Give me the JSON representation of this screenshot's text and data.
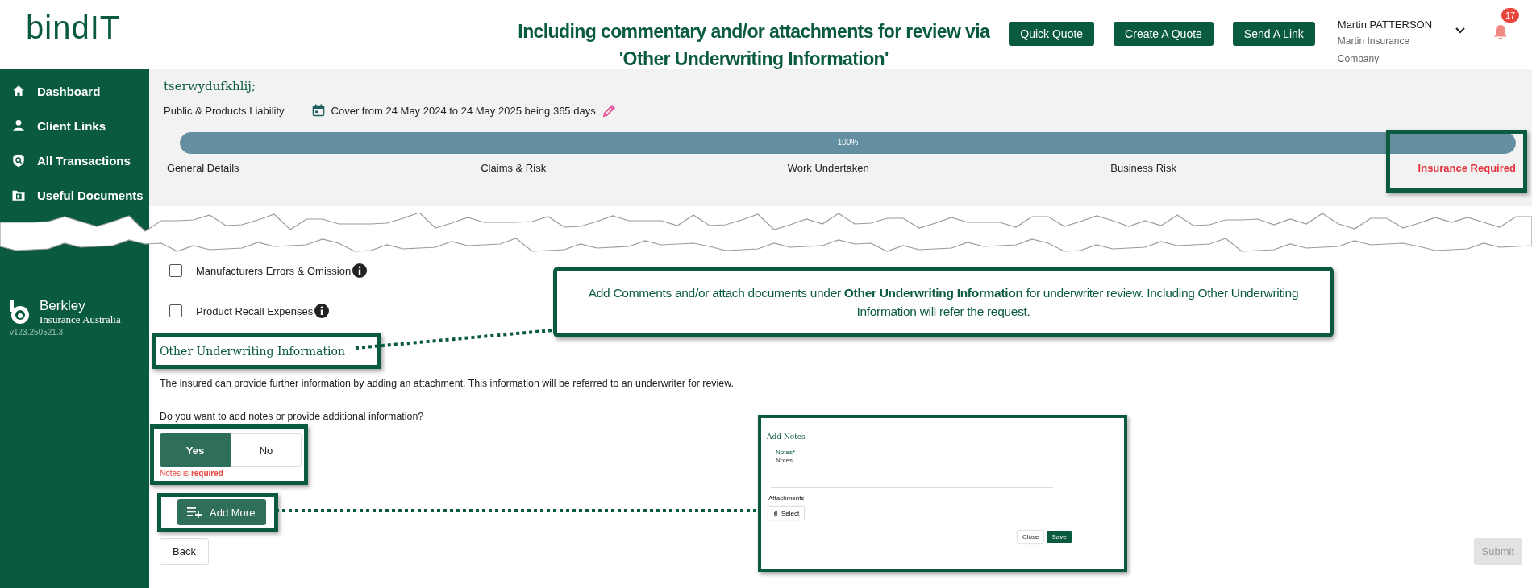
{
  "header": {
    "logo": "bindIT",
    "title_lines": [
      "Including commentary and/or attachments for review via",
      "'Other Underwriting Information'"
    ],
    "buttons": [
      "Quick Quote",
      "Create A Quote",
      "Send A Link"
    ],
    "user": {
      "name": "Martin PATTERSON",
      "company": "Martin Insurance Company"
    },
    "notifications": "17"
  },
  "sidebar": {
    "items": [
      {
        "label": "Dashboard",
        "kind": "home"
      },
      {
        "label": "Client Links",
        "kind": "person"
      },
      {
        "label": "All Transactions",
        "kind": "shield"
      },
      {
        "label": "Useful Documents",
        "kind": "document"
      }
    ],
    "brand": {
      "name": "Berkley",
      "subtitle": "Insurance Australia"
    },
    "version": "v123.250521.3"
  },
  "quote": {
    "title": "tserwydufkhlij;",
    "product": "Public & Products Liability",
    "cover": "Cover from 24 May 2024 to 24 May 2025 being 365 days",
    "progress": {
      "level": 1,
      "label": "100%"
    },
    "steps": [
      {
        "label": "General Details",
        "selected": false
      },
      {
        "label": "Claims & Risk",
        "selected": false
      },
      {
        "label": "Work Undertaken",
        "selected": false
      },
      {
        "label": "Business Risk",
        "selected": false
      },
      {
        "label": "Insurance Required",
        "selected": true
      }
    ]
  },
  "options": [
    {
      "label": "Manufacturers Errors & Omission",
      "checked": false
    },
    {
      "label": "Product Recall Expenses",
      "checked": false
    }
  ],
  "other_info": {
    "heading": "Other Underwriting Information",
    "description": "The insured can provide further information by adding an attachment. This information will be referred to an underwriter for review.",
    "question": "Do you want to add notes or provide additional information?",
    "choices": [
      {
        "label": "Yes",
        "selected": true
      },
      {
        "label": "No",
        "selected": false
      }
    ],
    "error": "Notes is **required**",
    "add_more": "Add More"
  },
  "footer": {
    "back": "Back",
    "submit": {
      "label": "Submit",
      "disabled": true
    }
  },
  "callout": {
    "text": "Add Comments and/or attach documents under **Other Underwriting Information** for underwriter review.  Including Other Underwriting Information will refer the request."
  },
  "inset": {
    "title": "Add Notes",
    "field_label": "Notes*",
    "field_value": "Notes",
    "attachments_label": "Attachments",
    "select": "Select",
    "buttons": [
      {
        "label": "Close",
        "kind": "secondary"
      },
      {
        "label": "Save",
        "kind": "primary"
      }
    ]
  }
}
